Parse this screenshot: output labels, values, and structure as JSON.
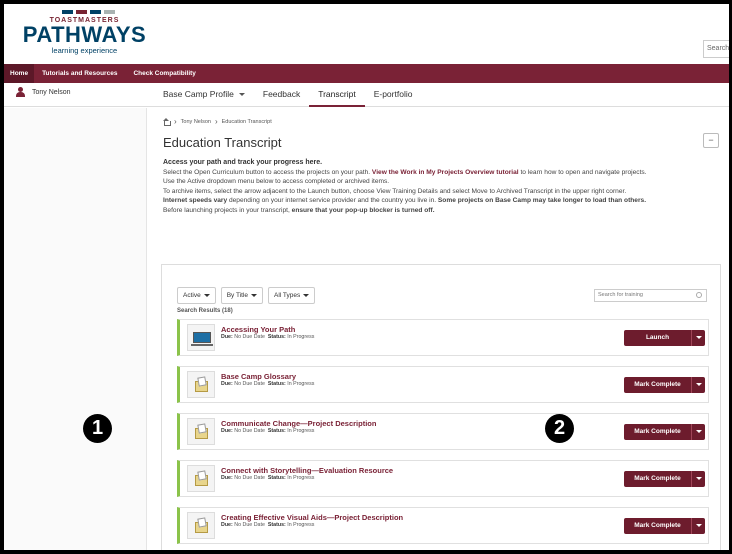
{
  "header": {
    "logo_top": "TOASTMASTERS",
    "logo_main": "PATHWAYS",
    "logo_sub": "learning experience",
    "search_placeholder": "Search",
    "logo_colors": [
      "#004165",
      "#772432",
      "#004165",
      "#a9b2b1"
    ]
  },
  "nav": {
    "items": [
      "Home",
      "Tutorials and Resources",
      "Check Compatibility"
    ]
  },
  "user": {
    "name": "Tony Nelson",
    "icon": "user-icon"
  },
  "tabs": [
    {
      "label": "Base Camp Profile",
      "has_dropdown": true
    },
    {
      "label": "Feedback"
    },
    {
      "label": "Transcript",
      "active": true
    },
    {
      "label": "E-portfolio"
    }
  ],
  "breadcrumb": {
    "user": "Tony Nelson",
    "page": "Education Transcript"
  },
  "page": {
    "title": "Education Transcript",
    "collapse": "−"
  },
  "intro": {
    "heading": "Access your path and track your progress here.",
    "p1_before": "Select the Open Curriculum button to access the projects on your path. ",
    "p1_link": "View the Work in My Projects Overview tutorial",
    "p1_after": " to learn how to open and navigate projects.",
    "p2": "Use the Active dropdown menu below to access completed or archived items.",
    "p3": "To archive items, select the arrow adjacent to the Launch button, choose View Training Details and select Move to Archived Transcript in the upper right corner.",
    "p4_bold": "Internet speeds vary",
    "p4_mid": " depending on your internet service provider and the country you live in. ",
    "p4_bold2": "Some projects on Base Camp may take longer to load than others.",
    "p5_before": "Before launching projects in your transcript, ",
    "p5_bold": "ensure that your pop-up blocker is turned off."
  },
  "filters": {
    "status": "Active",
    "sort": "By Title",
    "type": "All Types",
    "search_placeholder": "Search for training",
    "results": "Search Results (18)"
  },
  "items": [
    {
      "title": "Accessing Your Path",
      "due_label": "Due:",
      "due": "No Due Date",
      "status_label": "Status:",
      "status": "In Progress",
      "action": "Launch",
      "thumb": "laptop-icon"
    },
    {
      "title": "Base Camp Glossary",
      "due_label": "Due:",
      "due": "No Due Date",
      "status_label": "Status:",
      "status": "In Progress",
      "action": "Mark Complete",
      "thumb": "document-icon"
    },
    {
      "title": "Communicate Change—Project Description",
      "due_label": "Due:",
      "due": "No Due Date",
      "status_label": "Status:",
      "status": "In Progress",
      "action": "Mark Complete",
      "thumb": "document-icon"
    },
    {
      "title": "Connect with Storytelling—Evaluation Resource",
      "due_label": "Due:",
      "due": "No Due Date",
      "status_label": "Status:",
      "status": "In Progress",
      "action": "Mark Complete",
      "thumb": "document-icon"
    },
    {
      "title": "Creating Effective Visual Aids—Project Description",
      "due_label": "Due:",
      "due": "No Due Date",
      "status_label": "Status:",
      "status": "In Progress",
      "action": "Mark Complete",
      "thumb": "document-icon"
    }
  ],
  "markers": [
    "❶",
    "❷"
  ]
}
